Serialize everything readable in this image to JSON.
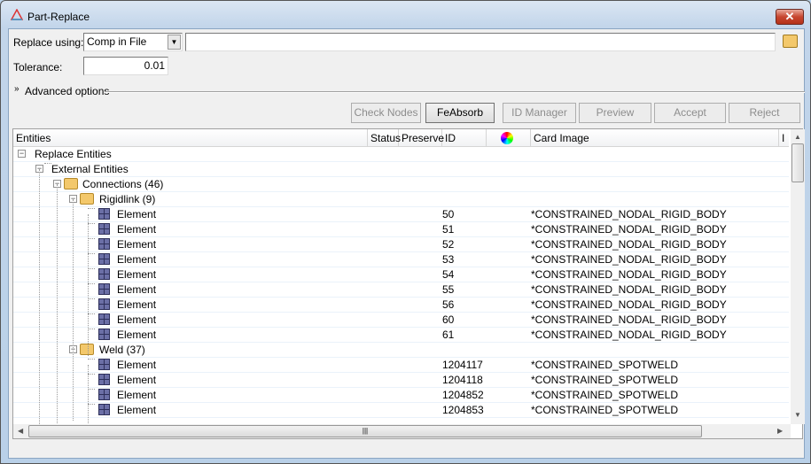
{
  "window": {
    "title": "Part-Replace",
    "close_label": "✕"
  },
  "form": {
    "replace_using_label": "Replace using:",
    "replace_using_value": "Comp in File",
    "file_path_value": "",
    "tolerance_label": "Tolerance:",
    "tolerance_value": "0.01",
    "advanced_options_label": "Advanced options"
  },
  "buttons": [
    {
      "label": "Check Nodes",
      "enabled": false
    },
    {
      "label": "FeAbsorb",
      "enabled": true
    },
    {
      "label": "ID Manager",
      "enabled": false
    },
    {
      "label": "Preview",
      "enabled": false
    },
    {
      "label": "Accept",
      "enabled": false
    },
    {
      "label": "Reject",
      "enabled": false
    }
  ],
  "columns": [
    "Entities",
    "Status",
    "Preserve",
    "ID",
    "color-wheel-icon",
    "Card Image",
    "I"
  ],
  "tree": {
    "root": "Replace Entities",
    "external": "External Entities",
    "connections": "Connections (46)",
    "rigidlink": "Rigidlink (9)",
    "weld": "Weld (37)",
    "rigid_elements": [
      {
        "label": "Element",
        "id": "50",
        "card": "*CONSTRAINED_NODAL_RIGID_BODY"
      },
      {
        "label": "Element",
        "id": "51",
        "card": "*CONSTRAINED_NODAL_RIGID_BODY"
      },
      {
        "label": "Element",
        "id": "52",
        "card": "*CONSTRAINED_NODAL_RIGID_BODY"
      },
      {
        "label": "Element",
        "id": "53",
        "card": "*CONSTRAINED_NODAL_RIGID_BODY"
      },
      {
        "label": "Element",
        "id": "54",
        "card": "*CONSTRAINED_NODAL_RIGID_BODY"
      },
      {
        "label": "Element",
        "id": "55",
        "card": "*CONSTRAINED_NODAL_RIGID_BODY"
      },
      {
        "label": "Element",
        "id": "56",
        "card": "*CONSTRAINED_NODAL_RIGID_BODY"
      },
      {
        "label": "Element",
        "id": "60",
        "card": "*CONSTRAINED_NODAL_RIGID_BODY"
      },
      {
        "label": "Element",
        "id": "61",
        "card": "*CONSTRAINED_NODAL_RIGID_BODY"
      }
    ],
    "weld_elements": [
      {
        "label": "Element",
        "id": "1204117",
        "card": "*CONSTRAINED_SPOTWELD"
      },
      {
        "label": "Element",
        "id": "1204118",
        "card": "*CONSTRAINED_SPOTWELD"
      },
      {
        "label": "Element",
        "id": "1204852",
        "card": "*CONSTRAINED_SPOTWELD"
      },
      {
        "label": "Element",
        "id": "1204853",
        "card": "*CONSTRAINED_SPOTWELD"
      }
    ]
  }
}
